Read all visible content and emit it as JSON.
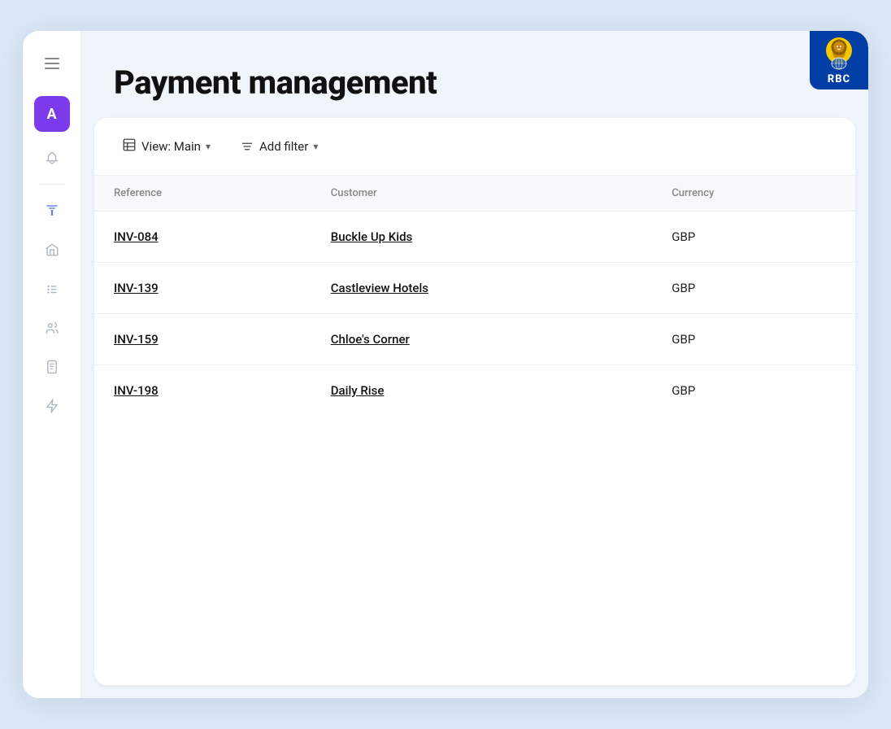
{
  "app": {
    "title": "Payment management"
  },
  "rbc": {
    "label": "RBC"
  },
  "sidebar": {
    "avatar_label": "A",
    "menu_items": [
      {
        "id": "home",
        "icon": "home-icon"
      },
      {
        "id": "tasks",
        "icon": "tasks-icon"
      },
      {
        "id": "users",
        "icon": "users-icon"
      },
      {
        "id": "invoice",
        "icon": "invoice-icon"
      },
      {
        "id": "lightning",
        "icon": "lightning-icon"
      }
    ]
  },
  "toolbar": {
    "view_label": "View: Main",
    "filter_label": "Add filter"
  },
  "table": {
    "headers": [
      "Reference",
      "Customer",
      "Currency"
    ],
    "rows": [
      {
        "reference": "INV-084",
        "customer": "Buckle Up Kids",
        "currency": "GBP"
      },
      {
        "reference": "INV-139",
        "customer": "Castleview Hotels",
        "currency": "GBP"
      },
      {
        "reference": "INV-159",
        "customer": "Chloe's Corner",
        "currency": "GBP"
      },
      {
        "reference": "INV-198",
        "customer": "Daily Rise",
        "currency": "GBP"
      }
    ]
  }
}
